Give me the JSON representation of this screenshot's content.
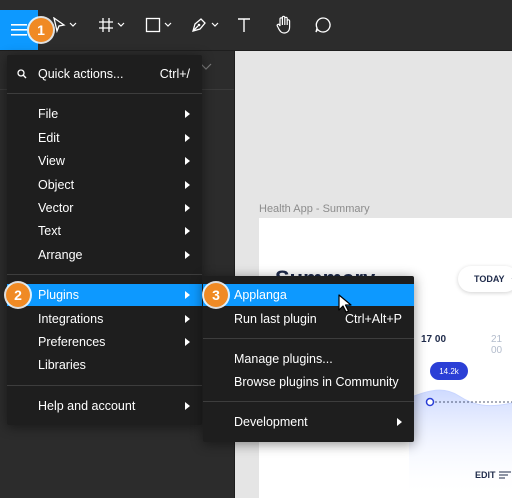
{
  "toolbar": {
    "tools": [
      "menu-icon",
      "move-icon",
      "frame-icon",
      "shape-icon",
      "pen-icon",
      "text-icon",
      "hand-icon",
      "comment-icon"
    ]
  },
  "steps": [
    "1",
    "2",
    "3"
  ],
  "main_menu": {
    "quick_actions": {
      "label": "Quick actions...",
      "shortcut": "Ctrl+/"
    },
    "items": [
      {
        "label": "File"
      },
      {
        "label": "Edit"
      },
      {
        "label": "View"
      },
      {
        "label": "Object"
      },
      {
        "label": "Vector"
      },
      {
        "label": "Text"
      },
      {
        "label": "Arrange"
      }
    ],
    "group2": [
      {
        "label": "Plugins"
      },
      {
        "label": "Integrations"
      },
      {
        "label": "Preferences"
      },
      {
        "label": "Libraries"
      }
    ],
    "help": {
      "label": "Help and account"
    }
  },
  "plugins_menu": {
    "applanga": "Applanga",
    "run_last": {
      "label": "Run last plugin",
      "shortcut": "Ctrl+Alt+P"
    },
    "manage": "Manage plugins...",
    "browse": "Browse plugins in Community",
    "development": "Development"
  },
  "canvas": {
    "frame_label": "Health App - Summary",
    "frame_title": "Summary",
    "today_label": "TODAY",
    "time1": "17 00",
    "time2": "21 00",
    "bubble": "14.2k",
    "edit_label": "EDIT"
  },
  "colors": {
    "accent": "#0d99ff",
    "badge": "#f08a24",
    "menu_bg": "#1e1e1e",
    "toolbar_bg": "#2c2c2c"
  }
}
